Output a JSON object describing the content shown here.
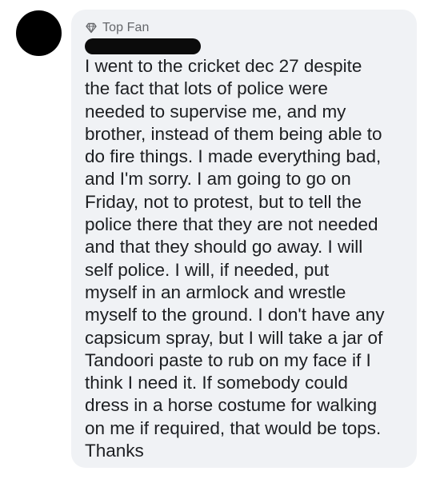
{
  "comment": {
    "badge": {
      "icon": "diamond-icon",
      "label": "Top Fan"
    },
    "author_name": "",
    "text": "I went to the cricket dec 27 despite\nthe fact that lots of police were\nneeded to supervise me, and my\nbrother, instead of them being able to\ndo fire things. I made everything bad,\nand I'm sorry. I am going to go on\nFriday, not to protest, but to tell the\npolice there that they are not needed\nand that they should go away. I will\nself police. I will, if needed, put\nmyself in an armlock and wrestle\nmyself to the ground. I don't have any\ncapsicum spray, but I will take a jar of\nTandoori paste to rub on my face if I\nthink I need it. If somebody could\ndress in a horse costume for walking\non me if required, that would be tops.\nThanks"
  },
  "colors": {
    "bubble_background": "#f0f2f5",
    "text": "#1c1e21",
    "badge_text": "#65676b",
    "avatar": "#000000",
    "redaction": "#0b0b0b"
  }
}
